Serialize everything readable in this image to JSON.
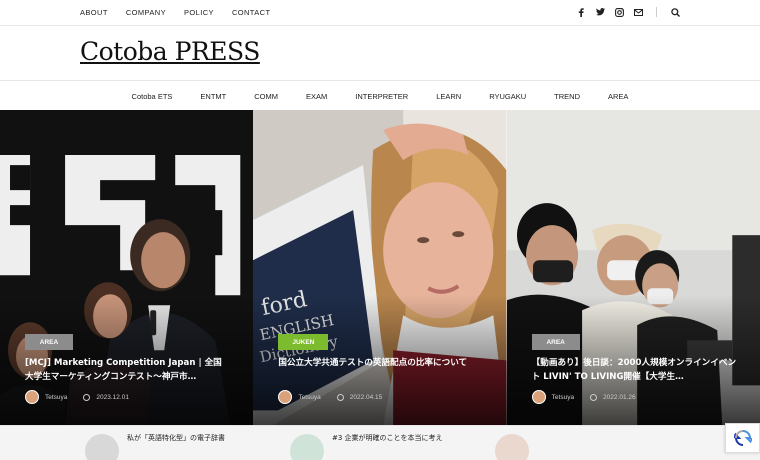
{
  "topnav": {
    "items": [
      "ABOUT",
      "COMPANY",
      "POLICY",
      "CONTACT"
    ]
  },
  "social": {
    "icons": [
      "facebook-icon",
      "twitter-icon",
      "instagram-icon",
      "mail-icon"
    ],
    "search_icon": "search-icon"
  },
  "logo": {
    "text": "Cotoba PRESS"
  },
  "catnav": {
    "items": [
      "Cotoba ETS",
      "ENTMT",
      "COMM",
      "EXAM",
      "INTERPRETER",
      "LEARN",
      "RYUGAKU",
      "TREND",
      "AREA"
    ]
  },
  "hero": {
    "cards": [
      {
        "badge": "AREA",
        "badge_color": "#8c8c8c",
        "title": "[MCJ] Marketing Competition Japan | 全国大学生マーケティングコンテスト～神戸市…",
        "author": "Tetsuya",
        "date": "2023.12.01"
      },
      {
        "badge": "JUKEN",
        "badge_color": "#7dbb2e",
        "title": "国公立大学共通テストの英語配点の比率について",
        "author": "Tetsuya",
        "date": "2022.04.15"
      },
      {
        "badge": "AREA",
        "badge_color": "#8c8c8c",
        "title": "【動画あり】後日談：2000人規模オンラインイベント LIVIN' TO LIVING開催【大学生…",
        "author": "Tetsuya",
        "date": "2022.01.26"
      }
    ]
  },
  "strip": {
    "items": [
      {
        "text": "私が「英語特化型」の電子辞書"
      },
      {
        "text": "#3 企業が明確のことを本当に考え"
      }
    ]
  }
}
